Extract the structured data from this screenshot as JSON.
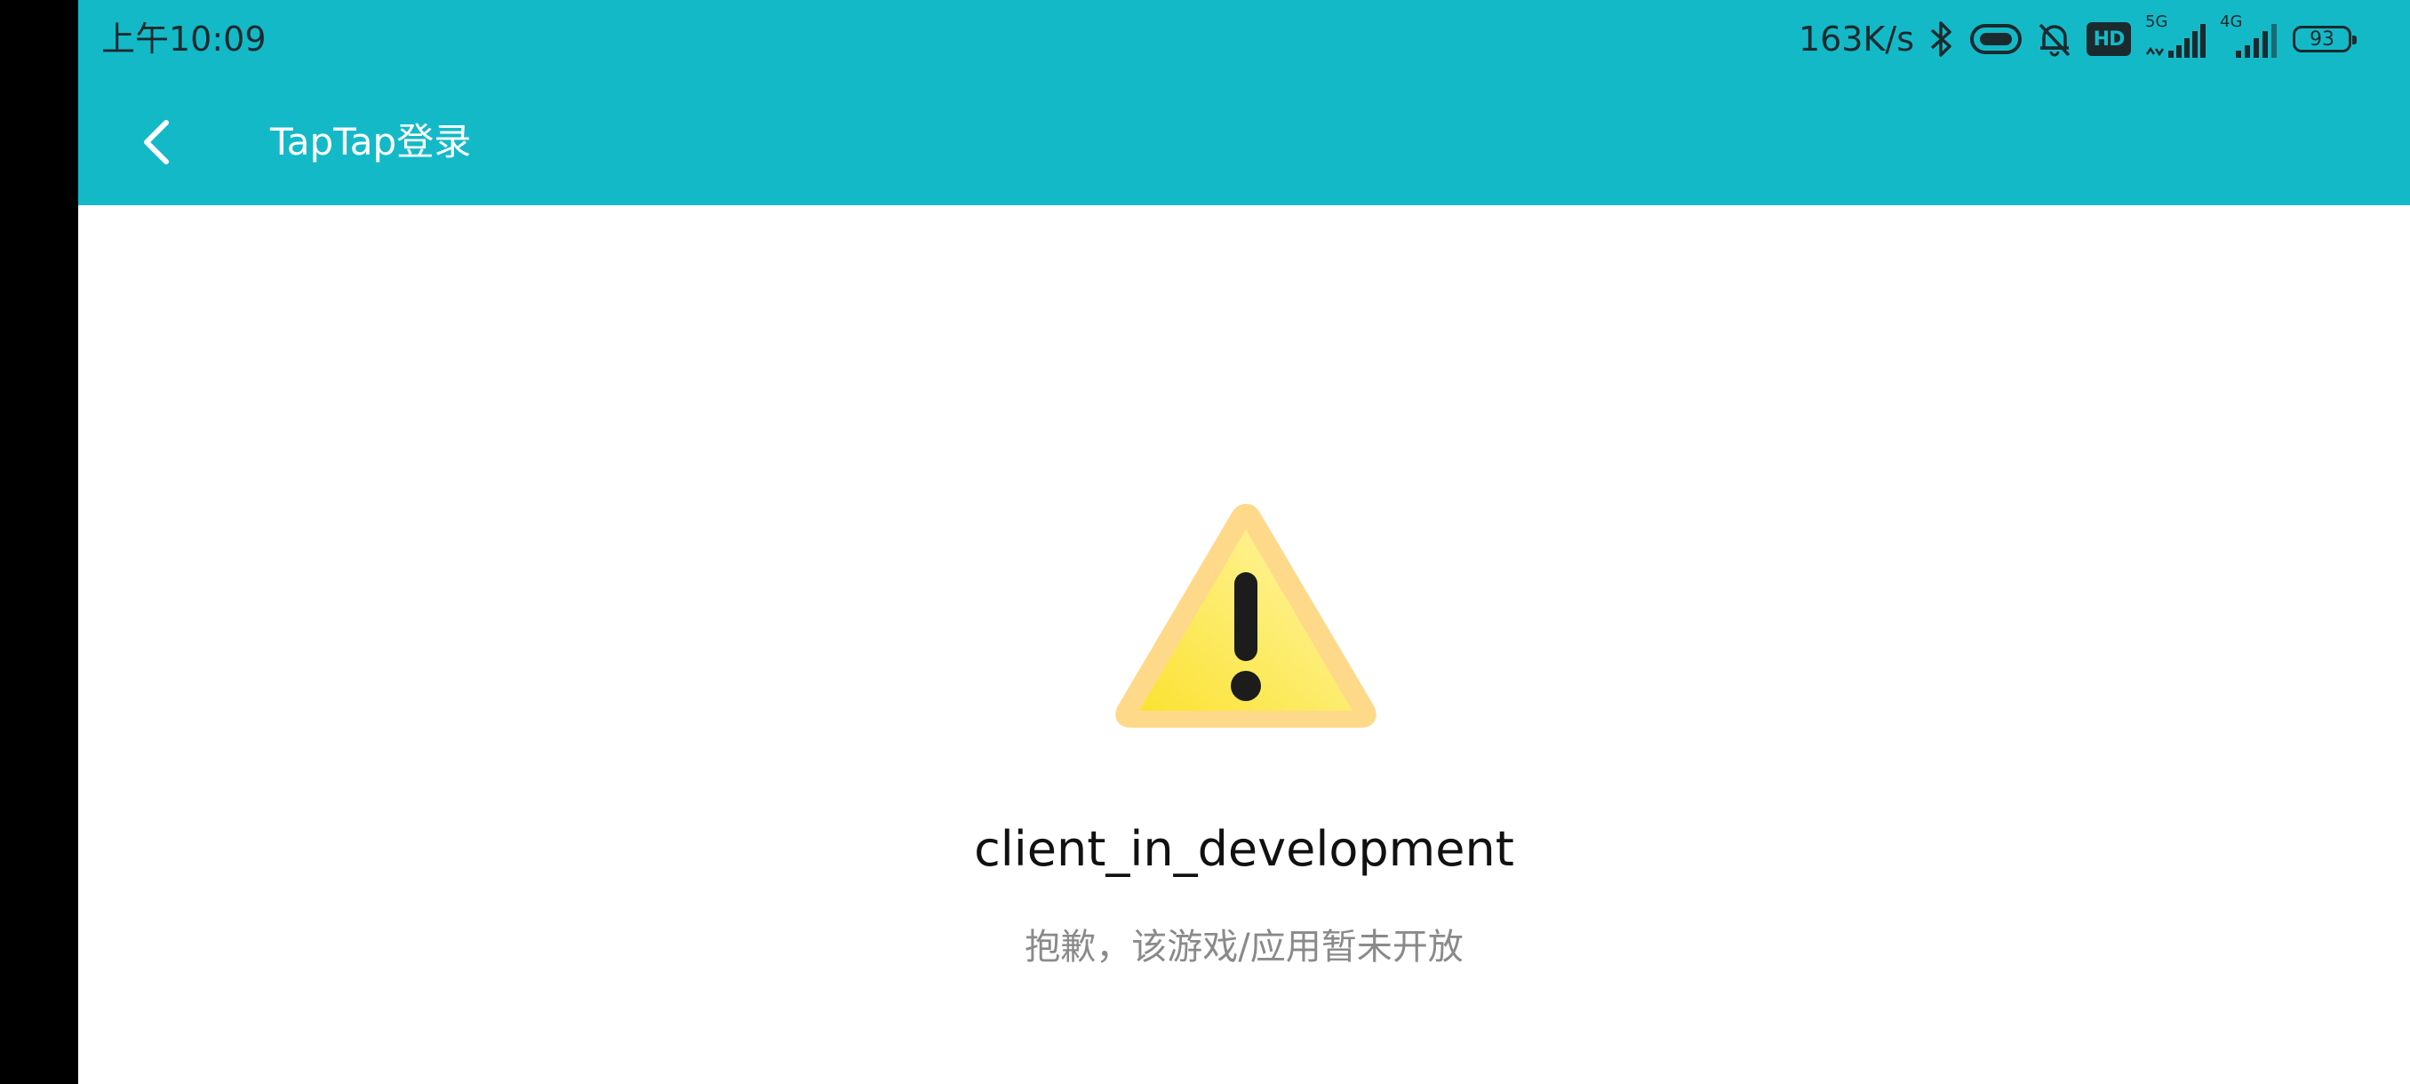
{
  "status_bar": {
    "time": "上午10:09",
    "network_speed": "163K/s",
    "battery_level": "93",
    "signal_1_label": "5G",
    "signal_2_label": "4G",
    "hd_badge": "HD",
    "icons": [
      "bluetooth-icon",
      "link-icon",
      "mute-bell-icon",
      "hd-icon",
      "signal-5g-icon",
      "signal-4g-icon",
      "battery-icon"
    ]
  },
  "header": {
    "back_icon": "chevron-left-icon",
    "title": "TapTap登录"
  },
  "main": {
    "icon": "warning-triangle-icon",
    "headline": "client_in_development",
    "message": "抱歉，该游戏/应用暂未开放"
  },
  "colors": {
    "accent": "#14b9c8",
    "warning_fill": "#fbe86a",
    "warning_border": "#ffd98a",
    "text_primary": "#111111",
    "text_secondary": "#8a8a8a"
  }
}
